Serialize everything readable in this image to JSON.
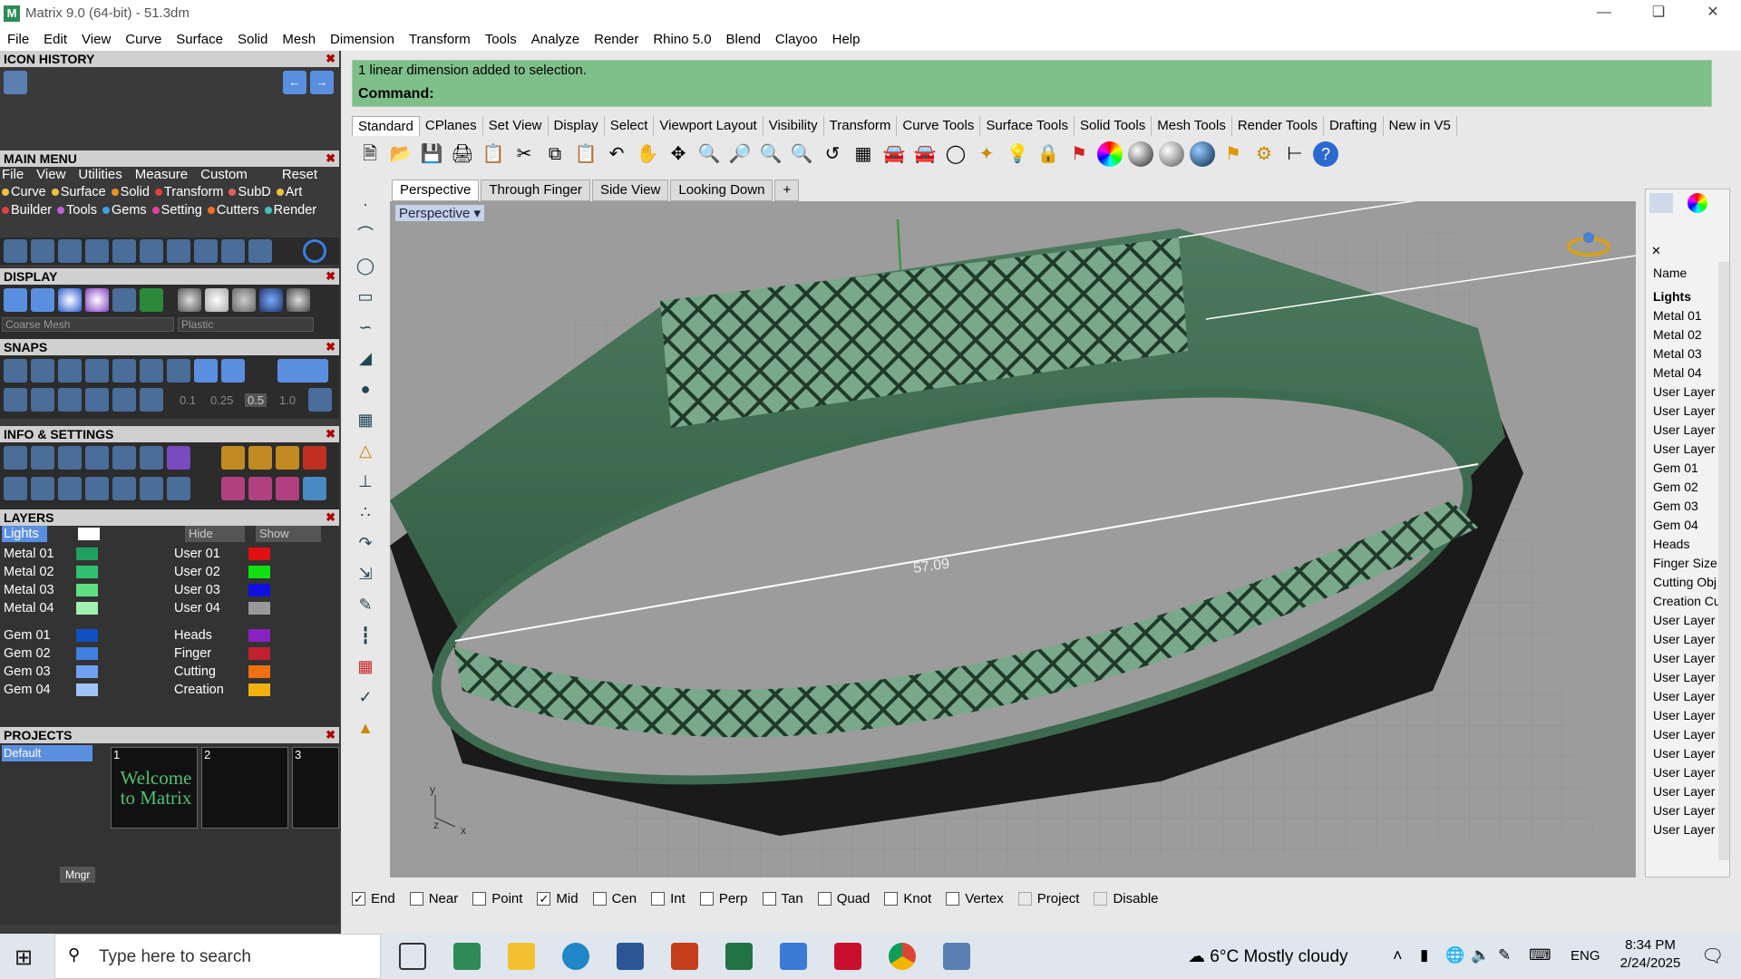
{
  "window": {
    "title": "Matrix 9.0 (64-bit) - 51.3dm",
    "logo": "M"
  },
  "menubar": [
    "File",
    "Edit",
    "View",
    "Curve",
    "Surface",
    "Solid",
    "Mesh",
    "Dimension",
    "Transform",
    "Tools",
    "Analyze",
    "Render",
    "Rhino 5.0",
    "Blend",
    "Clayoo",
    "Help"
  ],
  "left": {
    "icon_history": "ICON HISTORY",
    "main_menu": "MAIN MENU",
    "main_menu_items": [
      "File",
      "View",
      "Utilities",
      "Measure",
      "Custom"
    ],
    "reset": "Reset",
    "categories_row1": [
      "Curve",
      "Surface",
      "Solid",
      "Transform",
      "SubD",
      "Art"
    ],
    "categories_row2": [
      "Builder",
      "Tools",
      "Gems",
      "Setting",
      "Cutters",
      "Render"
    ],
    "display": "DISPLAY",
    "display_mesh": "Coarse Mesh",
    "display_material": "Plastic",
    "snaps": "SNAPS",
    "snap_values": [
      "0.1",
      "0.25",
      "0.5",
      "1.0"
    ],
    "info": "INFO & SETTINGS",
    "layers": "LAYERS",
    "active_layer": "Lights",
    "hide": "Hide",
    "show": "Show",
    "layer_left": [
      "Metal 01",
      "Metal 02",
      "Metal 03",
      "Metal 04",
      "Gem 01",
      "Gem 02",
      "Gem 03",
      "Gem 04"
    ],
    "layer_right": [
      "User 01",
      "User 02",
      "User 03",
      "User 04",
      "Heads",
      "Finger",
      "Cutting",
      "Creation"
    ],
    "projects": "PROJECTS",
    "project_default": "Default",
    "project_nums": [
      "1",
      "2",
      "3"
    ],
    "welcome": "Welcome to Matrix",
    "mngr": "Mngr"
  },
  "command": {
    "history": "1 linear dimension added to selection.",
    "prompt": "Command:"
  },
  "tabs": [
    "Standard",
    "CPlanes",
    "Set View",
    "Display",
    "Select",
    "Viewport Layout",
    "Visibility",
    "Transform",
    "Curve Tools",
    "Surface Tools",
    "Solid Tools",
    "Mesh Tools",
    "Render Tools",
    "Drafting",
    "New in V5"
  ],
  "viewport_tabs": [
    "Perspective",
    "Through Finger",
    "Side View",
    "Looking Down"
  ],
  "viewport": {
    "label": "Perspective",
    "dimension": "57.09",
    "axis_y": "y",
    "axis_z": "z",
    "axis_x": "x"
  },
  "layers_panel": {
    "header": "Name",
    "items": [
      "Lights",
      "Metal 01",
      "Metal 02",
      "Metal 03",
      "Metal 04",
      "User Layer",
      "User Layer",
      "User Layer",
      "User Layer",
      "Gem 01",
      "Gem 02",
      "Gem 03",
      "Gem 04",
      "Heads",
      "Finger Size",
      "Cutting Obj",
      "Creation Cu",
      "User Layer",
      "User Layer",
      "User Layer",
      "User Layer",
      "User Layer",
      "User Layer",
      "User Layer",
      "User Layer",
      "User Layer",
      "User Layer",
      "User Layer",
      "User Layer"
    ]
  },
  "osnaps": [
    {
      "label": "End",
      "checked": true
    },
    {
      "label": "Near",
      "checked": false
    },
    {
      "label": "Point",
      "checked": false
    },
    {
      "label": "Mid",
      "checked": true
    },
    {
      "label": "Cen",
      "checked": false
    },
    {
      "label": "Int",
      "checked": false
    },
    {
      "label": "Perp",
      "checked": false
    },
    {
      "label": "Tan",
      "checked": false
    },
    {
      "label": "Quad",
      "checked": false
    },
    {
      "label": "Knot",
      "checked": false
    },
    {
      "label": "Vertex",
      "checked": false
    },
    {
      "label": "Project",
      "checked": false
    },
    {
      "label": "Disable",
      "checked": false
    }
  ],
  "taskbar": {
    "search": "Type here to search",
    "weather": "6°C  Mostly cloudy",
    "lang": "ENG",
    "time": "8:34 PM",
    "date": "2/24/2025"
  },
  "colors": {
    "command_bg": "#7fbf8a",
    "ring": "#3d6b4f",
    "viewport_bg": "#9c9c9c"
  }
}
